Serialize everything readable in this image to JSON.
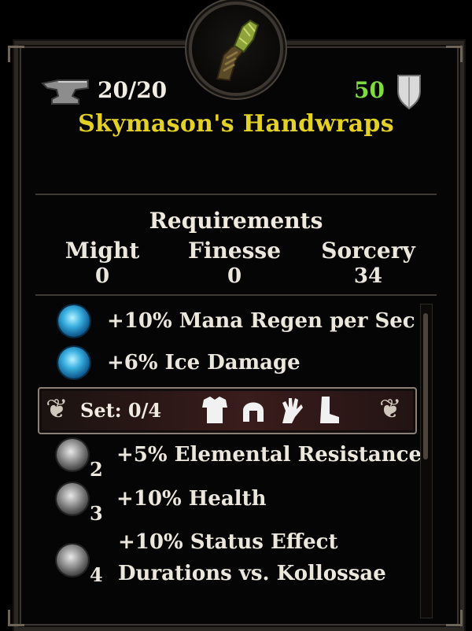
{
  "header": {
    "durability": "20/20",
    "armor": "50",
    "item_name": "Skymason's Handwraps",
    "item_icon": "handwraps-icon"
  },
  "requirements": {
    "title": "Requirements",
    "stats": [
      {
        "name": "Might",
        "value": "0"
      },
      {
        "name": "Finesse",
        "value": "0"
      },
      {
        "name": "Sorcery",
        "value": "34"
      }
    ]
  },
  "bonuses": [
    {
      "text": "+10% Mana Regen per Sec",
      "icon": "mana-gem-icon"
    },
    {
      "text": "+6% Ice Damage",
      "icon": "ice-gem-icon"
    }
  ],
  "set": {
    "label": "Set: 0/4",
    "pieces": [
      "chest-armor-icon",
      "helm-icon",
      "gauntlet-icon",
      "boots-icon"
    ]
  },
  "set_bonuses": [
    {
      "rank": "2",
      "text": "+5% Elemental Resistance",
      "icon": "arrow-gem-icon"
    },
    {
      "rank": "3",
      "text": "+10% Health",
      "icon": "cross-gem-icon"
    },
    {
      "rank": "4",
      "line1": "+10% Status Effect",
      "line2": "Durations vs. Kollossae",
      "icon": "tower-gem-icon"
    }
  ],
  "colors": {
    "item_name": "#e4d126",
    "armor_value": "#7fdc3e",
    "text": "#ece7dc"
  }
}
